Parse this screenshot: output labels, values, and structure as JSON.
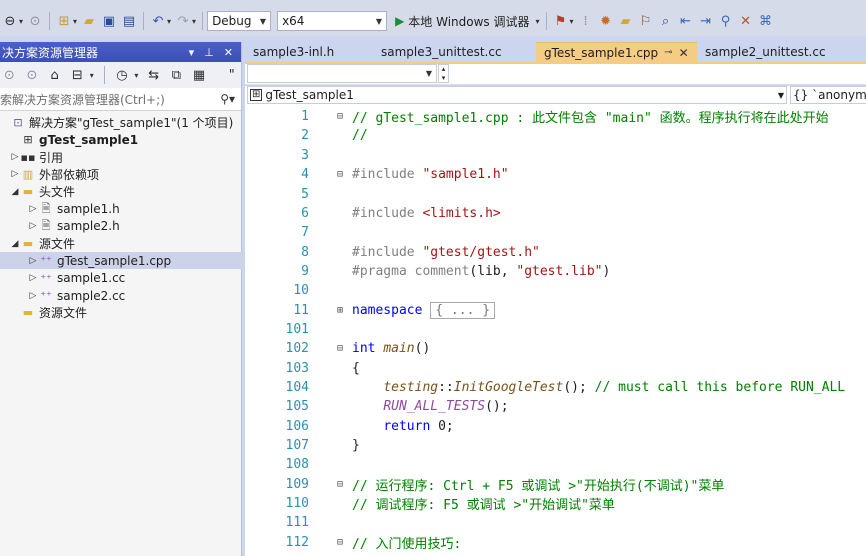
{
  "toolbar": {
    "config": "Debug",
    "platform": "x64",
    "run_label": "本地 Windows 调试器"
  },
  "solution_explorer": {
    "title": "决方案资源管理器",
    "search_placeholder": "索解决方案资源管理器(Ctrl+;)",
    "tree": [
      {
        "label": "解决方案\"gTest_sample1\"(1 个项目)",
        "icon": "solution-icon",
        "indent": 0,
        "twisty": ""
      },
      {
        "label": "gTest_sample1",
        "icon": "project-icon",
        "indent": 1,
        "twisty": "",
        "bold": true
      },
      {
        "label": "引用",
        "icon": "references-icon",
        "indent": 2,
        "twisty": "▷"
      },
      {
        "label": "外部依赖项",
        "icon": "external-deps-icon",
        "indent": 2,
        "twisty": "▷"
      },
      {
        "label": "头文件",
        "icon": "folder-icon",
        "indent": 2,
        "twisty": "◢"
      },
      {
        "label": "sample1.h",
        "icon": "header-file-icon",
        "indent": 3,
        "twisty": "▷"
      },
      {
        "label": "sample2.h",
        "icon": "header-file-icon",
        "indent": 3,
        "twisty": "▷"
      },
      {
        "label": "源文件",
        "icon": "folder-icon",
        "indent": 2,
        "twisty": "◢"
      },
      {
        "label": "gTest_sample1.cpp",
        "icon": "cpp-file-icon",
        "indent": 3,
        "twisty": "▷",
        "selected": true
      },
      {
        "label": "sample1.cc",
        "icon": "cpp-file-icon",
        "indent": 3,
        "twisty": "▷"
      },
      {
        "label": "sample2.cc",
        "icon": "cpp-file-icon",
        "indent": 3,
        "twisty": "▷"
      },
      {
        "label": "资源文件",
        "icon": "folder-icon",
        "indent": 2,
        "twisty": ""
      }
    ]
  },
  "editor": {
    "tabs": [
      {
        "label": "sample3-inl.h",
        "active": false
      },
      {
        "label": "sample3_unittest.cc",
        "active": false
      },
      {
        "label": "gTest_sample1.cpp",
        "active": true
      },
      {
        "label": "sample2_unittest.cc",
        "active": false
      }
    ],
    "nav_project": "gTest_sample1",
    "nav_scope": "{} `anonymo",
    "lines": [
      {
        "n": "1",
        "fold": "⊟",
        "html": "<span class=\"cm\">// gTest_sample1.cpp : 此文件包含 \"main\" 函数。程序执行将在此处开始</span>"
      },
      {
        "n": "2",
        "fold": "",
        "html": "<span class=\"cm\">//</span>"
      },
      {
        "n": "3",
        "fold": "",
        "html": ""
      },
      {
        "n": "4",
        "fold": "⊟",
        "html": "<span class=\"pp\">#include </span><span class=\"str\">\"sample1.h\"</span>"
      },
      {
        "n": "5",
        "fold": "",
        "html": ""
      },
      {
        "n": "6",
        "fold": "",
        "html": "<span class=\"pp\">#include </span><span class=\"str\">&lt;limits.h&gt;</span>"
      },
      {
        "n": "7",
        "fold": "",
        "html": ""
      },
      {
        "n": "8",
        "fold": "",
        "html": "<span class=\"pp\">#include </span><span class=\"str\">\"gtest/gtest.h\"</span>"
      },
      {
        "n": "9",
        "fold": "",
        "html": "<span class=\"pp\">#pragma comment</span>(lib, <span class=\"str\">\"gtest.lib\"</span>)"
      },
      {
        "n": "10",
        "fold": "",
        "html": ""
      },
      {
        "n": "11",
        "fold": "⊞",
        "html": "<span class=\"kw\">namespace</span> <span class=\"collapsed\">{ ... }</span>"
      },
      {
        "n": "101",
        "fold": "",
        "html": ""
      },
      {
        "n": "102",
        "fold": "⊟",
        "html": "<span class=\"kw\">int</span> <span class=\"ital\">main</span>()"
      },
      {
        "n": "103",
        "fold": "",
        "html": "{"
      },
      {
        "n": "104",
        "fold": "",
        "html": "    <span class=\"ital\">testing</span>::<span class=\"ital\">InitGoogleTest</span>(); <span class=\"cm\">// must call this before RUN_ALL</span>"
      },
      {
        "n": "105",
        "fold": "",
        "html": "    <span class=\"mac\">RUN_ALL_TESTS</span>();"
      },
      {
        "n": "106",
        "fold": "",
        "html": "    <span class=\"kw\">return</span> 0;"
      },
      {
        "n": "107",
        "fold": "",
        "html": "}"
      },
      {
        "n": "108",
        "fold": "",
        "html": ""
      },
      {
        "n": "109",
        "fold": "⊟",
        "html": "<span class=\"cm\">// 运行程序: Ctrl + F5 或调试 &gt;\"开始执行(不调试)\"菜单</span>"
      },
      {
        "n": "110",
        "fold": "",
        "html": "<span class=\"cm\">// 调试程序: F5 或调试 &gt;\"开始调试\"菜单</span>"
      },
      {
        "n": "111",
        "fold": "",
        "html": ""
      },
      {
        "n": "112",
        "fold": "⊟",
        "html": "<span class=\"cm\">// 入门使用技巧:</span>"
      }
    ]
  }
}
